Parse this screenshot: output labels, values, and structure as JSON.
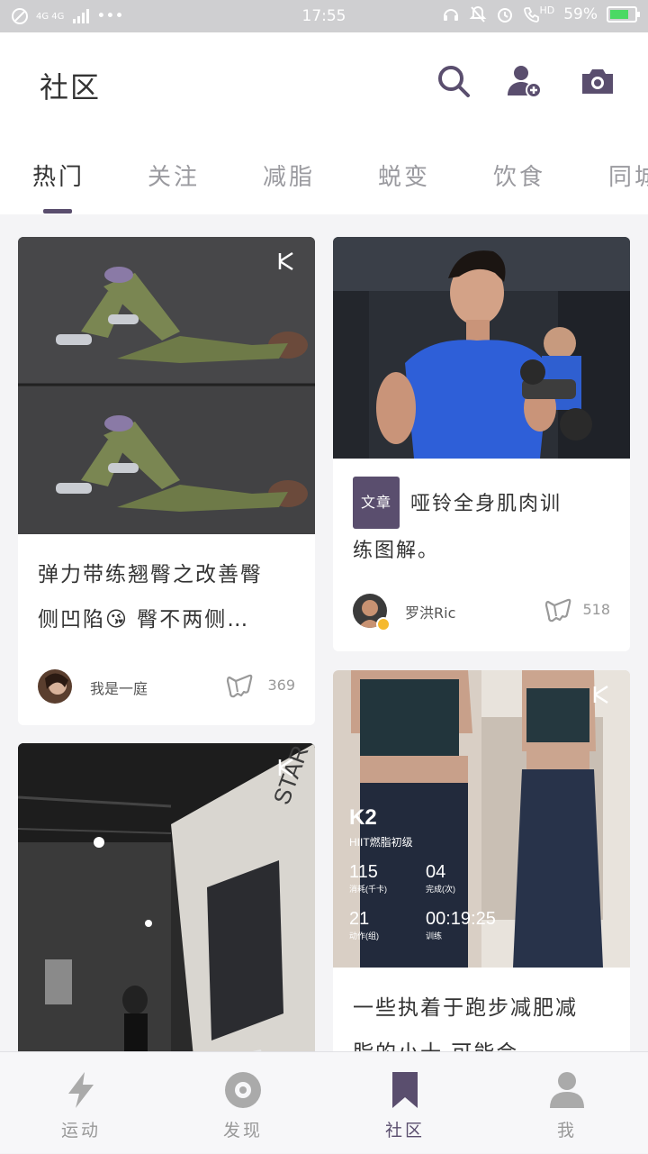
{
  "status_bar": {
    "network": "4G 4G",
    "dots": "•••",
    "time": "17:55",
    "hd": "HD",
    "battery": "59%"
  },
  "header": {
    "title": "社区",
    "icons": [
      "search-icon",
      "add-user-icon",
      "camera-icon"
    ]
  },
  "tabs": [
    {
      "label": "热门",
      "active": true
    },
    {
      "label": "关注"
    },
    {
      "label": "减脂"
    },
    {
      "label": "蜕变"
    },
    {
      "label": "饮食"
    },
    {
      "label": "同城"
    }
  ],
  "feed": {
    "cards": [
      {
        "title_line1": "弹力带练翘臀之改善臀",
        "title_line2_pre": "侧凹陷",
        "title_emoji": "😘",
        "title_line2_post": " 臀不两侧…",
        "author": "我是一庭",
        "likes": "369"
      },
      {
        "tag": "文章",
        "title_line1": "哑铃全身肌肉训",
        "title_line2": "练图解。",
        "author": "罗洪Ric",
        "likes": "518"
      },
      {
        "image_text": "STAR EN"
      },
      {
        "image_stats": {
          "course": "K2",
          "course_sub": "HIIT燃脂初级",
          "stat1_value": "115",
          "stat1_label": "消耗(千卡)",
          "stat2_value": "04",
          "stat2_label": "完成(次)",
          "stat3_value": "21",
          "stat3_label": "动作(组)",
          "stat4_value": "00:19:25",
          "stat4_label": "训练"
        },
        "title_line1": "一些执着于跑步减肥减",
        "title_line2": "脂的小十 可能会"
      }
    ]
  },
  "bottom_nav": [
    {
      "label": "运动",
      "icon": "lightning-icon"
    },
    {
      "label": "发现",
      "icon": "discover-icon"
    },
    {
      "label": "社区",
      "icon": "bookmark-icon",
      "active": true
    },
    {
      "label": "我",
      "icon": "person-icon"
    }
  ],
  "colors": {
    "accent": "#5a4e6e",
    "status_bar": "#cfcfd1",
    "background": "#f4f4f6",
    "battery": "#4bd964"
  }
}
